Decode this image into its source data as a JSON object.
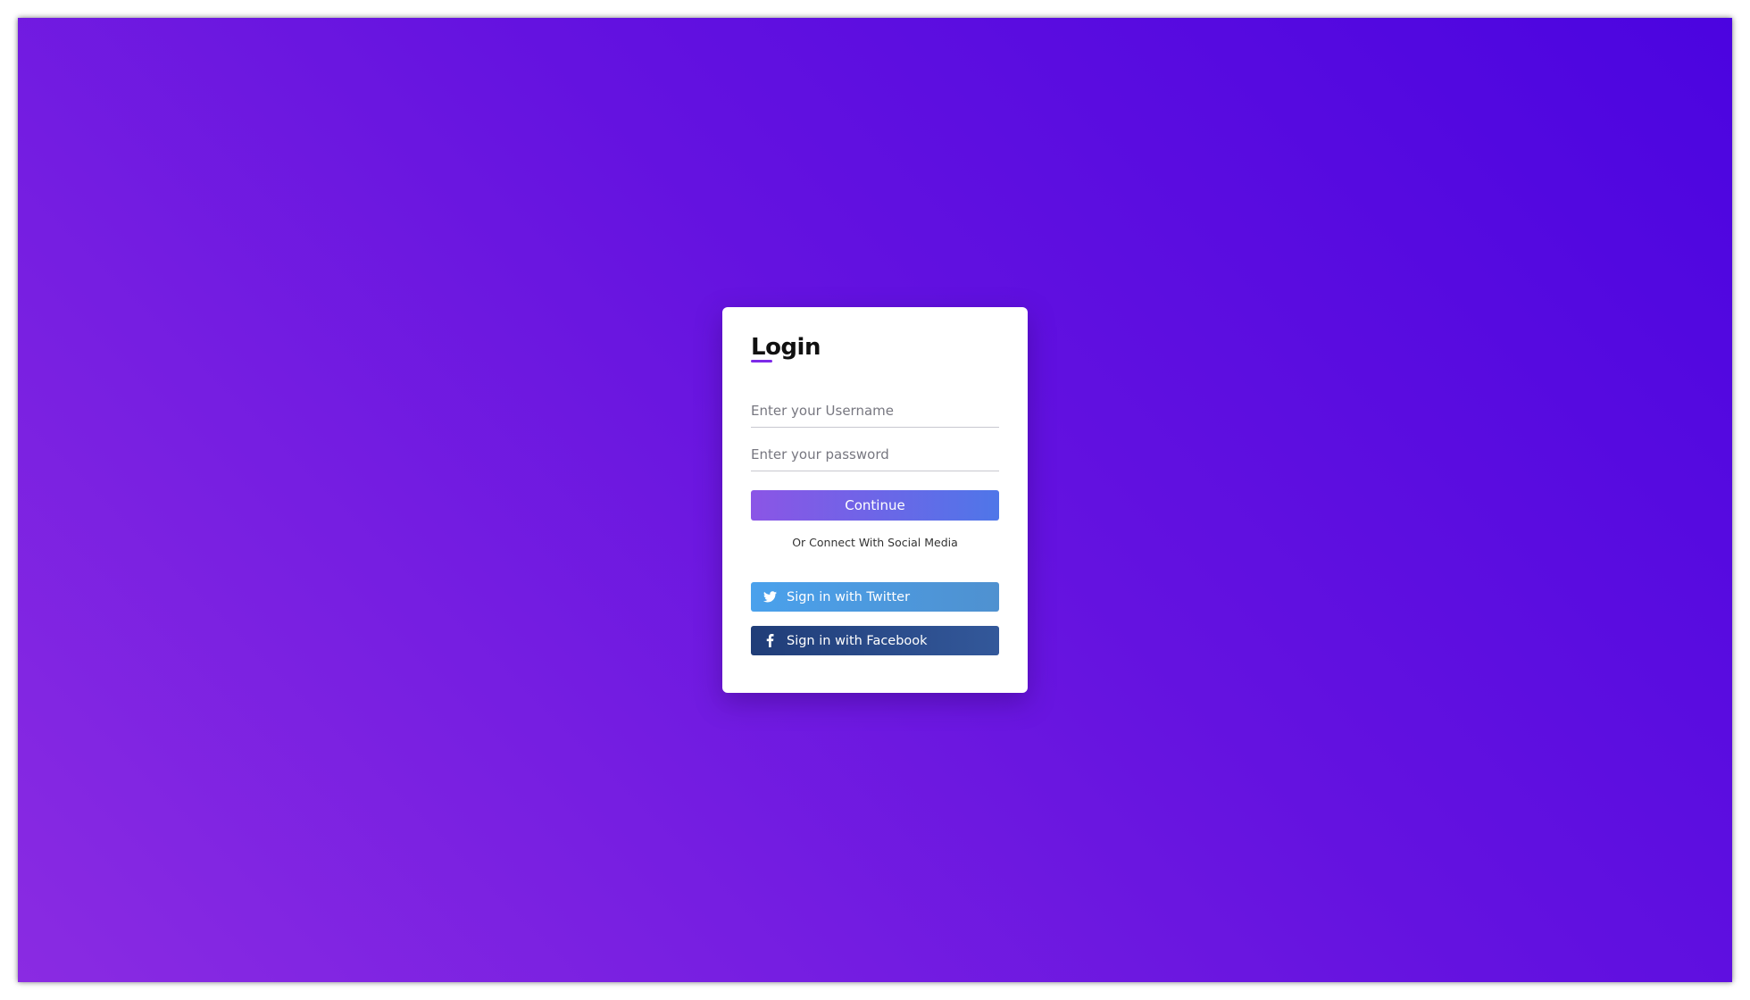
{
  "login": {
    "title": "Login",
    "username": {
      "placeholder": "Enter your Username",
      "value": ""
    },
    "password": {
      "placeholder": "Enter your password",
      "value": ""
    },
    "continue_label": "Continue",
    "social_divider": "Or Connect With Social Media",
    "twitter": {
      "label": "Sign in with Twitter",
      "icon": "twitter-icon"
    },
    "facebook": {
      "label": "Sign in with Facebook",
      "icon": "facebook-icon"
    }
  },
  "colors": {
    "background_start": "#8a2be2",
    "background_end": "#4b04e0",
    "accent": "#7d2ae8",
    "continue_start": "#8b55e6",
    "continue_end": "#4f76e8",
    "twitter": "#4aa1ec",
    "facebook": "#203d78"
  }
}
